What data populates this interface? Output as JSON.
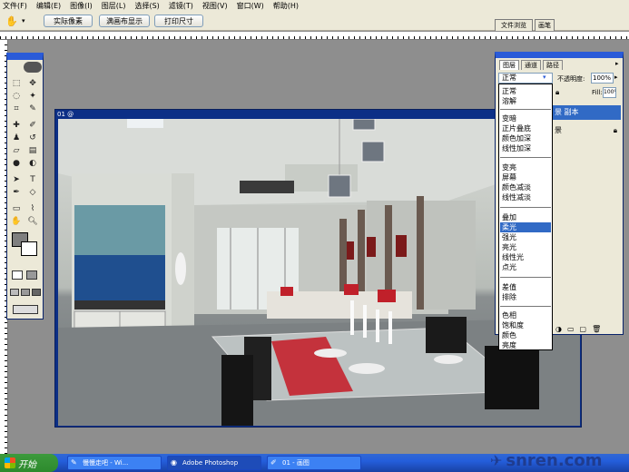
{
  "menu": [
    "文件(F)",
    "编辑(E)",
    "图像(I)",
    "图层(L)",
    "选择(S)",
    "滤镜(T)",
    "视图(V)",
    "窗口(W)",
    "帮助(H)"
  ],
  "options_bar": {
    "actual_pixels": "实际像素",
    "fit_screen": "满画布显示",
    "print_size": "打印尺寸",
    "tab_file_browser": "文件浏览",
    "tab_brushes": "画笔"
  },
  "document": {
    "title": "01 @"
  },
  "layers_panel": {
    "tabs": [
      "图层",
      "通道",
      "路径"
    ],
    "blend_mode": "正常",
    "opacity_label": "不透明度:",
    "opacity_value": "100%",
    "fill_label": "Fill:",
    "fill_value": "100%",
    "layer_selected": "景 副本",
    "layer_2": "景"
  },
  "blend_modes": {
    "group1": [
      "正常",
      "溶解"
    ],
    "group2": [
      "变暗",
      "正片叠底",
      "颜色加深",
      "线性加深"
    ],
    "group3": [
      "变亮",
      "屏幕",
      "颜色减淡",
      "线性减淡"
    ],
    "group4": [
      "叠加",
      "柔光",
      "强光",
      "亮光",
      "线性光",
      "点光"
    ],
    "group5": [
      "差值",
      "排除"
    ],
    "group6": [
      "色相",
      "饱和度",
      "颜色",
      "亮度"
    ],
    "highlighted": "柔光"
  },
  "taskbar": {
    "start": "开始",
    "items": [
      "慢慢走吧 - Wi...",
      "Adobe Photoshop",
      "01 - 画图"
    ]
  },
  "watermark": "snren.com",
  "colors": {
    "title_blue": "#2a5bd8",
    "highlight": "#316ac5",
    "taskbar": "#245edb"
  }
}
